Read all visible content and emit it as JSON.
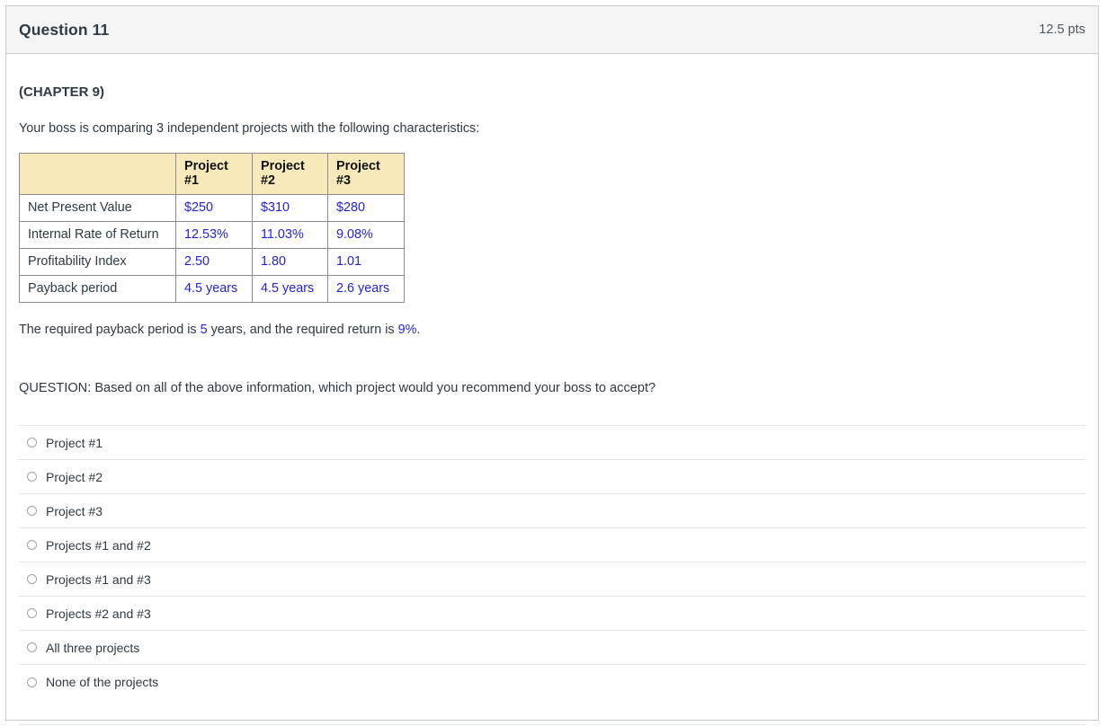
{
  "header": {
    "title": "Question 11",
    "points": "12.5 pts"
  },
  "content": {
    "chapter_label": "(CHAPTER 9)",
    "intro_text": "Your boss is comparing 3 independent projects with the following characteristics:",
    "required_line": {
      "part1": "The required payback period is ",
      "payback_value": "5",
      "part2": " years, and the required return is ",
      "return_value": "9%",
      "part3": "."
    },
    "question_line": "QUESTION: Based on all of the above information, which project would you recommend your boss to accept?"
  },
  "table": {
    "corner": "",
    "columns": [
      "Project #1",
      "Project #2",
      "Project #3"
    ],
    "rows": [
      {
        "label": "Net Present Value",
        "values": [
          "$250",
          "$310",
          "$280"
        ]
      },
      {
        "label": "Internal Rate of Return",
        "values": [
          "12.53%",
          "11.03%",
          "9.08%"
        ]
      },
      {
        "label": "Profitability Index",
        "values": [
          "2.50",
          "1.80",
          "1.01"
        ]
      },
      {
        "label": "Payback period",
        "values": [
          "4.5 years",
          "4.5 years",
          "2.6 years"
        ]
      }
    ]
  },
  "answers": [
    {
      "label": "Project #1",
      "selected": false
    },
    {
      "label": "Project #2",
      "selected": false
    },
    {
      "label": "Project #3",
      "selected": false
    },
    {
      "label": "Projects #1 and #2",
      "selected": false
    },
    {
      "label": "Projects #1 and #3",
      "selected": false
    },
    {
      "label": "Projects #2 and #3",
      "selected": false
    },
    {
      "label": "All three projects",
      "selected": false
    },
    {
      "label": "None of the projects",
      "selected": false
    }
  ],
  "colors": {
    "header_bg": "#f5f5f5",
    "table_header_bg": "#f7e9b9",
    "value_blue": "#2222dd",
    "text": "#2d3b45",
    "border": "#c7cdd1",
    "row_divider": "#e3e4e6"
  }
}
